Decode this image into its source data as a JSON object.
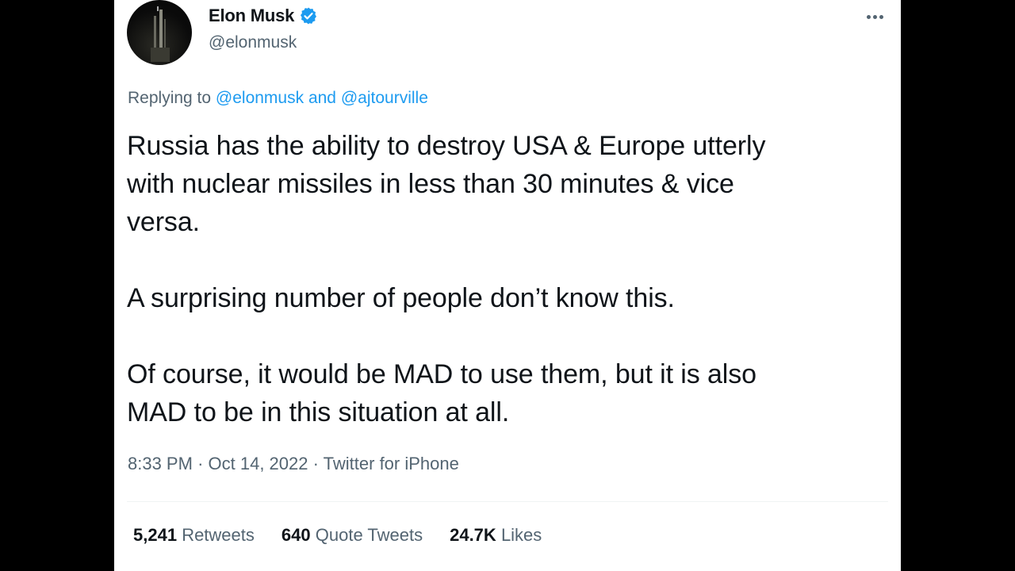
{
  "tweet": {
    "author": {
      "name": "Elon Musk",
      "handle": "@elonmusk",
      "verified": true,
      "avatar_icon": "rocket-night-avatar"
    },
    "menu_icon": "more-options-icon",
    "replying": {
      "prefix": "Replying to",
      "user1": "@elonmusk",
      "conjunction": "and",
      "user2": "@ajtourville"
    },
    "text": "Russia has the ability to destroy USA & Europe utterly\nwith nuclear missiles in less than 30 minutes & vice\nversa.\n\nA surprising number of people don’t know this.\n\nOf course, it would be MAD to use them, but it is also\nMAD to be in this situation at all.",
    "time": "8:33 PM",
    "date": "Oct 14, 2022",
    "source": "Twitter for iPhone",
    "separator": "·",
    "stats": {
      "retweets_count": "5,241",
      "retweets_label": "Retweets",
      "quotes_count": "640",
      "quotes_label": "Quote Tweets",
      "likes_count": "24.7K",
      "likes_label": "Likes"
    }
  },
  "colors": {
    "background": "#000000",
    "card": "#ffffff",
    "text": "#0f1419",
    "secondary": "#536471",
    "link": "#1d9bf0",
    "verified_badge": "#1d9bf0"
  }
}
